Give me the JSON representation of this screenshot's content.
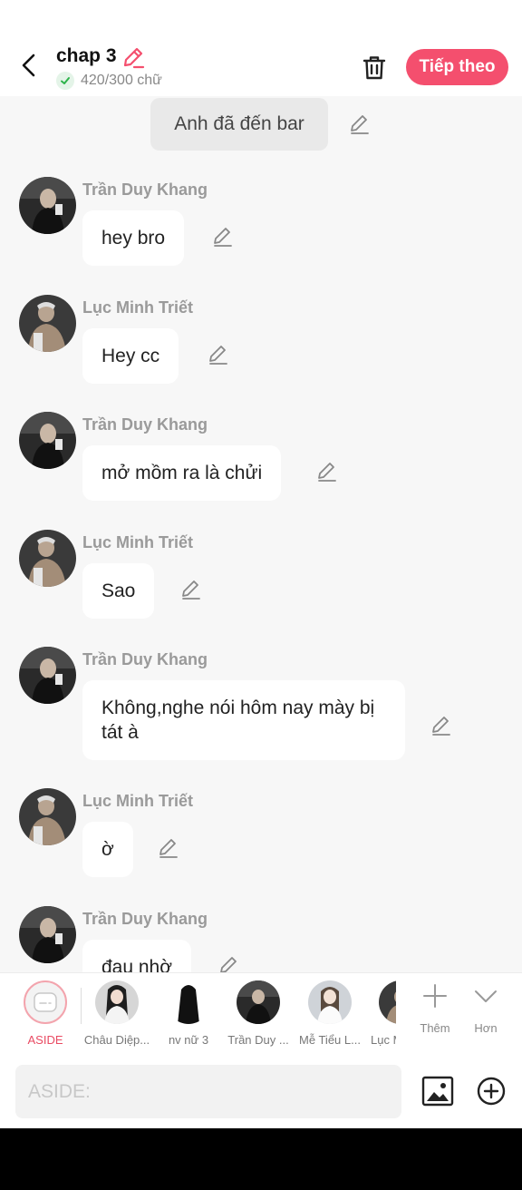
{
  "header": {
    "title": "chap 3",
    "word_count": "420/300 chữ",
    "next_label": "Tiếp theo",
    "accent": "#f44f6e"
  },
  "narration": {
    "text": "Anh đã đến bar"
  },
  "messages": [
    {
      "sender": "Trần Duy Khang",
      "text": "hey bro"
    },
    {
      "sender": "Lục Minh Triết",
      "text": "Hey cc"
    },
    {
      "sender": "Trần Duy Khang",
      "text": "mở mồm ra là chửi"
    },
    {
      "sender": "Lục Minh Triết",
      "text": "Sao"
    },
    {
      "sender": "Trần Duy Khang",
      "text": "Không,nghe nói hôm nay mày bị tát à"
    },
    {
      "sender": "Lục Minh Triết",
      "text": "ờ"
    },
    {
      "sender": "Trần Duy Khang",
      "text": "đau nhờ"
    }
  ],
  "characters": [
    {
      "label": "ASIDE"
    },
    {
      "label": "Châu Diệp..."
    },
    {
      "label": "nv nữ 3"
    },
    {
      "label": "Trần Duy ..."
    },
    {
      "label": "Mễ Tiểu L..."
    },
    {
      "label": "Lục M"
    }
  ],
  "tools": {
    "more_label": "Thêm",
    "expand_label": "Hơn"
  },
  "composer": {
    "placeholder": "ASIDE:"
  },
  "icons": {
    "back": "chevron-left-icon",
    "edit": "pencil-icon",
    "delete": "trash-icon",
    "image": "image-icon",
    "add": "plus-circle-icon"
  }
}
